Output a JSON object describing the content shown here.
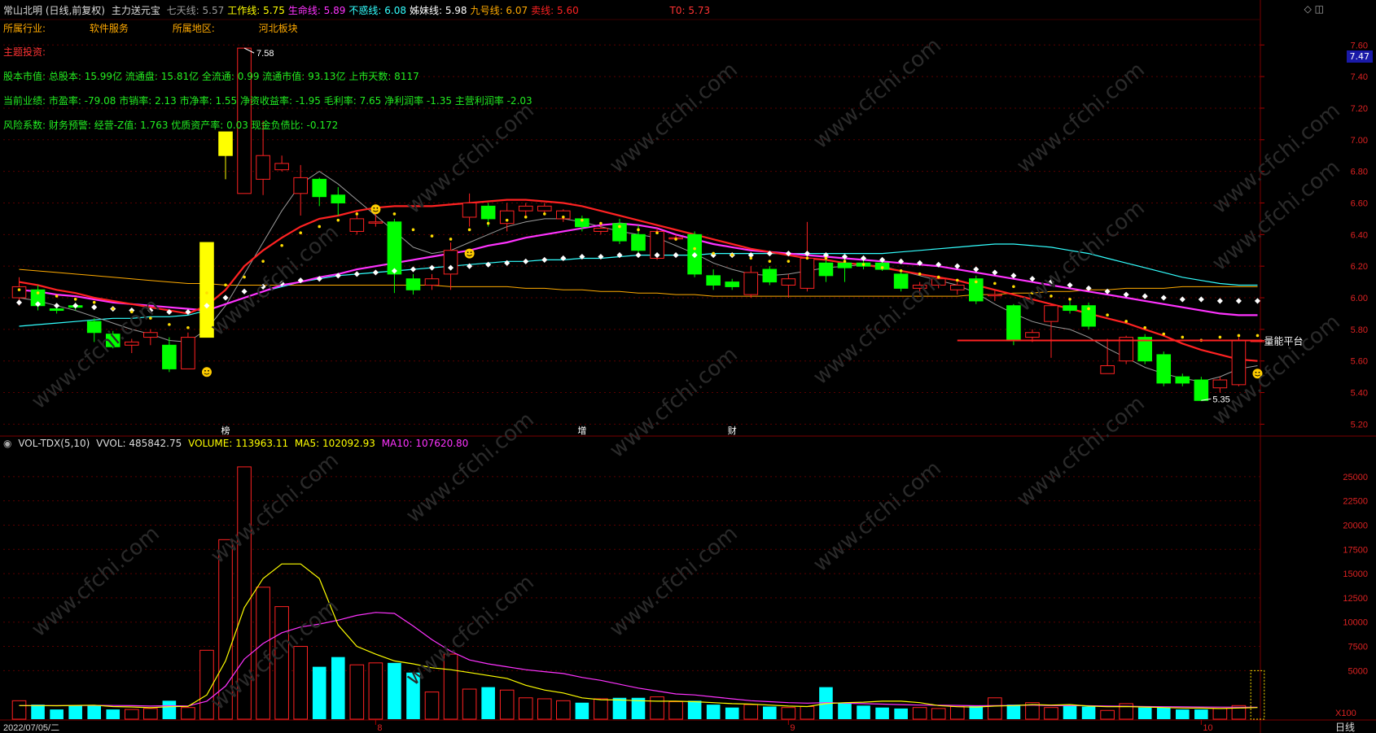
{
  "header": {
    "stock": "常山北明 (日线,前复权)",
    "indicator": "主力送元宝",
    "items": [
      {
        "label": "七天线:",
        "value": "5.57",
        "color": "#9a9a9a"
      },
      {
        "label": "工作线:",
        "value": "5.75",
        "color": "#ffff00"
      },
      {
        "label": "生命线:",
        "value": "5.89",
        "color": "#ff33ff"
      },
      {
        "label": "不惑线:",
        "value": "6.08",
        "color": "#33ffff"
      },
      {
        "label": "姊妹线:",
        "value": "5.98",
        "color": "#ffffff"
      },
      {
        "label": "九号线:",
        "value": "6.07",
        "color": "#ffaa00"
      },
      {
        "label": "卖线:",
        "value": "5.60",
        "color": "#ff2222"
      }
    ],
    "t0": "T0: 5.73"
  },
  "info": {
    "industry_label": "所属行业:",
    "industry_value": "软件服务",
    "region_label": "所属地区:",
    "region_value": "河北板块",
    "theme": "主题投资:",
    "capital": "股本市值: 总股本: 15.99亿 流通盘: 15.81亿 全流通: 0.99 流通市值: 93.13亿 上市天数: 8117",
    "performance": "当前业绩: 市盈率: -79.08 市销率: 2.13 市净率: 1.55 净资收益率: -1.95 毛利率: 7.65 净利润率 -1.35 主营利润率 -2.03",
    "risk": "风险系数: 财务预警: 经营-Z值: 1.763 优质资产率: 0.03 现金负债比: -0.172"
  },
  "annotations": {
    "high": "7.58",
    "low": "5.35",
    "platform": "量能平台",
    "markers": [
      "榜",
      "增",
      "财"
    ],
    "current_price": "7.47"
  },
  "volume_header": {
    "name": "VOL-TDX(5,10)",
    "vvol": "VVOL: 485842.75",
    "volume": "VOLUME: 113963.11",
    "ma5": "MA5: 102092.93",
    "ma10": "MA10: 107620.80"
  },
  "x_axis": {
    "start": "2022/07/05/二",
    "months": [
      "8",
      "9",
      "10"
    ],
    "unit": "X100",
    "period": "日线"
  },
  "colors": {
    "up": "#ff2222",
    "down": "#00ff00",
    "volume_down": "#00ffff",
    "ma_red": "#ff2222",
    "ma_magenta": "#ff33ff",
    "ma_cyan": "#33ffff",
    "ma_orange": "#ffaa00",
    "ma_gray": "#9a9a9a"
  },
  "chart_data": {
    "type": "candlestick",
    "y_ticks": [
      7.6,
      7.4,
      7.2,
      7.0,
      6.8,
      6.6,
      6.4,
      6.2,
      6.0,
      5.8,
      5.6,
      5.4,
      5.2
    ],
    "ylim": [
      5.13,
      7.73
    ],
    "volume_ticks": [
      25000,
      22500,
      20000,
      17500,
      15000,
      12500,
      10000,
      7500,
      5000
    ],
    "volume_ylim": [
      0,
      27500
    ],
    "candles": [
      [
        6.0,
        6.07,
        5.95,
        6.13
      ],
      [
        6.05,
        5.95,
        5.92,
        6.08
      ],
      [
        5.93,
        5.92,
        5.9,
        5.96
      ],
      [
        5.95,
        5.94,
        5.92,
        5.97
      ],
      [
        5.85,
        5.78,
        5.72,
        5.87
      ],
      [
        5.77,
        5.69,
        5.68,
        5.79
      ],
      [
        5.7,
        5.72,
        5.65,
        5.74
      ],
      [
        5.75,
        5.78,
        5.7,
        5.8
      ],
      [
        5.7,
        5.55,
        5.53,
        5.75
      ],
      [
        5.55,
        5.75,
        5.55,
        5.78
      ],
      [
        5.75,
        6.35,
        5.75,
        6.35
      ],
      [
        6.9,
        7.05,
        6.75,
        7.05
      ],
      [
        6.66,
        7.58,
        6.66,
        7.58
      ],
      [
        6.75,
        6.9,
        6.65,
        7.12
      ],
      [
        6.81,
        6.85,
        6.8,
        6.9
      ],
      [
        6.66,
        6.76,
        6.52,
        6.84
      ],
      [
        6.75,
        6.64,
        6.58,
        6.76
      ],
      [
        6.65,
        6.6,
        6.52,
        6.7
      ],
      [
        6.42,
        6.5,
        6.4,
        6.55
      ],
      [
        6.48,
        6.48,
        6.45,
        6.56
      ],
      [
        6.48,
        6.15,
        6.03,
        6.5
      ],
      [
        6.12,
        6.05,
        6.02,
        6.15
      ],
      [
        6.08,
        6.12,
        6.05,
        6.15
      ],
      [
        6.15,
        6.3,
        6.05,
        6.35
      ],
      [
        6.51,
        6.6,
        6.45,
        6.66
      ],
      [
        6.58,
        6.5,
        6.45,
        6.6
      ],
      [
        6.47,
        6.55,
        6.42,
        6.6
      ],
      [
        6.55,
        6.58,
        6.52,
        6.6
      ],
      [
        6.55,
        6.58,
        6.53,
        6.6
      ],
      [
        6.5,
        6.55,
        6.48,
        6.56
      ],
      [
        6.5,
        6.45,
        6.42,
        6.52
      ],
      [
        6.42,
        6.44,
        6.4,
        6.48
      ],
      [
        6.47,
        6.36,
        6.34,
        6.5
      ],
      [
        6.4,
        6.3,
        6.28,
        6.46
      ],
      [
        6.25,
        6.42,
        6.24,
        6.44
      ],
      [
        6.38,
        6.38,
        6.36,
        6.4
      ],
      [
        6.4,
        6.15,
        6.13,
        6.42
      ],
      [
        6.14,
        6.08,
        6.05,
        6.18
      ],
      [
        6.1,
        6.07,
        6.05,
        6.12
      ],
      [
        6.02,
        6.16,
        6.0,
        6.2
      ],
      [
        6.18,
        6.1,
        6.08,
        6.2
      ],
      [
        6.08,
        6.12,
        6.0,
        6.15
      ],
      [
        6.06,
        6.25,
        6.04,
        6.48
      ],
      [
        6.22,
        6.14,
        6.1,
        6.24
      ],
      [
        6.22,
        6.19,
        6.1,
        6.25
      ],
      [
        6.22,
        6.2,
        6.18,
        6.24
      ],
      [
        6.22,
        6.18,
        6.17,
        6.23
      ],
      [
        6.15,
        6.06,
        6.04,
        6.16
      ],
      [
        6.06,
        6.08,
        6.02,
        6.1
      ],
      [
        6.08,
        6.12,
        6.06,
        6.14
      ],
      [
        6.05,
        6.08,
        6.02,
        6.1
      ],
      [
        6.12,
        5.98,
        5.96,
        6.14
      ],
      [
        6.02,
        6.02,
        5.98,
        6.05
      ],
      [
        5.95,
        5.73,
        5.7,
        5.96
      ],
      [
        5.75,
        5.78,
        5.72,
        5.8
      ],
      [
        5.85,
        5.95,
        5.62,
        5.96
      ],
      [
        5.95,
        5.92,
        5.9,
        5.98
      ],
      [
        5.95,
        5.82,
        5.8,
        5.97
      ],
      [
        5.52,
        5.57,
        5.52,
        5.74
      ],
      [
        5.6,
        5.75,
        5.58,
        5.76
      ],
      [
        5.75,
        5.6,
        5.58,
        5.77
      ],
      [
        5.64,
        5.46,
        5.44,
        5.66
      ],
      [
        5.5,
        5.46,
        5.44,
        5.52
      ],
      [
        5.48,
        5.35,
        5.35,
        5.5
      ],
      [
        5.43,
        5.48,
        5.4,
        5.5
      ],
      [
        5.45,
        5.73,
        5.44,
        5.75
      ],
      [
        5.73,
        5.73,
        5.73,
        5.73
      ]
    ],
    "ma_red": [
      6.1,
      6.08,
      6.05,
      6.03,
      6.0,
      5.98,
      5.96,
      5.94,
      5.92,
      5.9,
      5.95,
      6.05,
      6.2,
      6.3,
      6.38,
      6.45,
      6.5,
      6.52,
      6.55,
      6.57,
      6.58,
      6.58,
      6.58,
      6.59,
      6.6,
      6.61,
      6.62,
      6.62,
      6.61,
      6.6,
      6.58,
      6.55,
      6.52,
      6.49,
      6.46,
      6.43,
      6.4,
      6.37,
      6.34,
      6.31,
      6.29,
      6.27,
      6.25,
      6.24,
      6.22,
      6.21,
      6.19,
      6.17,
      6.15,
      6.13,
      6.11,
      6.08,
      6.05,
      6.02,
      5.99,
      5.96,
      5.93,
      5.9,
      5.87,
      5.84,
      5.8,
      5.76,
      5.71,
      5.67,
      5.64,
      5.61,
      5.6
    ],
    "ma_magenta": [
      6.05,
      6.04,
      6.02,
      6.01,
      5.99,
      5.97,
      5.96,
      5.95,
      5.94,
      5.93,
      5.92,
      5.96,
      6.0,
      6.04,
      6.08,
      6.1,
      6.13,
      6.15,
      6.18,
      6.2,
      6.22,
      6.24,
      6.26,
      6.28,
      6.3,
      6.33,
      6.35,
      6.38,
      6.4,
      6.42,
      6.44,
      6.46,
      6.47,
      6.46,
      6.44,
      6.4,
      6.37,
      6.34,
      6.32,
      6.3,
      6.29,
      6.28,
      6.27,
      6.26,
      6.25,
      6.24,
      6.23,
      6.22,
      6.21,
      6.2,
      6.18,
      6.16,
      6.14,
      6.12,
      6.1,
      6.08,
      6.06,
      6.04,
      6.02,
      6.0,
      5.98,
      5.96,
      5.94,
      5.92,
      5.9,
      5.89,
      5.89
    ],
    "ma_cyan": [
      5.82,
      5.83,
      5.84,
      5.85,
      5.86,
      5.87,
      5.87,
      5.88,
      5.88,
      5.89,
      5.92,
      5.96,
      6.0,
      6.04,
      6.07,
      6.1,
      6.12,
      6.14,
      6.15,
      6.16,
      6.17,
      6.18,
      6.19,
      6.2,
      6.21,
      6.22,
      6.23,
      6.23,
      6.24,
      6.24,
      6.25,
      6.25,
      6.26,
      6.27,
      6.27,
      6.27,
      6.27,
      6.28,
      6.28,
      6.28,
      6.28,
      6.28,
      6.28,
      6.28,
      6.28,
      6.28,
      6.28,
      6.29,
      6.3,
      6.31,
      6.32,
      6.33,
      6.34,
      6.34,
      6.33,
      6.32,
      6.3,
      6.28,
      6.25,
      6.22,
      6.19,
      6.16,
      6.13,
      6.11,
      6.09,
      6.08,
      6.08
    ],
    "ma_orange": [
      6.18,
      6.17,
      6.16,
      6.15,
      6.14,
      6.13,
      6.12,
      6.11,
      6.1,
      6.09,
      6.09,
      6.08,
      6.08,
      6.08,
      6.08,
      6.08,
      6.08,
      6.08,
      6.08,
      6.08,
      6.08,
      6.08,
      6.08,
      6.07,
      6.07,
      6.07,
      6.07,
      6.06,
      6.06,
      6.05,
      6.05,
      6.04,
      6.04,
      6.03,
      6.03,
      6.02,
      6.02,
      6.01,
      6.01,
      6.01,
      6.01,
      6.01,
      6.01,
      6.01,
      6.01,
      6.01,
      6.01,
      6.01,
      6.01,
      6.01,
      6.01,
      6.02,
      6.02,
      6.03,
      6.03,
      6.04,
      6.04,
      6.05,
      6.05,
      6.06,
      6.06,
      6.06,
      6.07,
      6.07,
      6.07,
      6.07,
      6.07
    ],
    "ma_gray": [
      6.0,
      5.98,
      5.95,
      5.92,
      5.88,
      5.84,
      5.8,
      5.77,
      5.73,
      5.72,
      5.8,
      5.95,
      6.15,
      6.35,
      6.55,
      6.72,
      6.8,
      6.72,
      6.62,
      6.52,
      6.42,
      6.32,
      6.28,
      6.3,
      6.35,
      6.4,
      6.45,
      6.48,
      6.5,
      6.5,
      6.48,
      6.45,
      6.42,
      6.4,
      6.38,
      6.33,
      6.28,
      6.22,
      6.18,
      6.15,
      6.14,
      6.15,
      6.17,
      6.19,
      6.2,
      6.21,
      6.2,
      6.17,
      6.14,
      6.11,
      6.08,
      6.03,
      5.96,
      5.9,
      5.85,
      5.82,
      5.8,
      5.75,
      5.68,
      5.62,
      5.56,
      5.52,
      5.49,
      5.47,
      5.5,
      5.55,
      5.57
    ],
    "dots_white": [
      5.97,
      5.96,
      5.95,
      5.95,
      5.94,
      5.93,
      5.92,
      5.92,
      5.91,
      5.91,
      5.95,
      6.0,
      6.04,
      6.07,
      6.09,
      6.11,
      6.12,
      6.14,
      6.15,
      6.16,
      6.17,
      6.18,
      6.19,
      6.19,
      6.2,
      6.21,
      6.22,
      6.23,
      6.24,
      6.25,
      6.26,
      6.26,
      6.27,
      6.27,
      6.27,
      6.27,
      6.27,
      6.27,
      6.27,
      6.27,
      6.28,
      6.28,
      6.28,
      6.27,
      6.26,
      6.25,
      6.24,
      6.23,
      6.22,
      6.21,
      6.2,
      6.18,
      6.16,
      6.14,
      6.12,
      6.1,
      6.08,
      6.06,
      6.04,
      6.02,
      6.01,
      6.0,
      5.99,
      5.99,
      5.98,
      5.98,
      5.98
    ],
    "dots_yellow": [
      6.02,
      6.0,
      5.98,
      5.96,
      5.94,
      5.9,
      5.88,
      5.84,
      5.8,
      5.78,
      6.0,
      6.05,
      6.1,
      6.2,
      6.3,
      6.38,
      6.42,
      6.46,
      6.5,
      6.52,
      6.5,
      6.4,
      6.36,
      6.34,
      6.4,
      6.44,
      6.46,
      6.48,
      6.5,
      6.48,
      6.46,
      6.44,
      6.42,
      6.4,
      6.38,
      6.34,
      6.28,
      6.25,
      6.24,
      6.22,
      6.2,
      6.2,
      6.22,
      6.22,
      6.2,
      6.18,
      6.16,
      6.14,
      6.12,
      6.1,
      6.08,
      6.07,
      6.06,
      6.04,
      6.0,
      5.98,
      5.96,
      5.9,
      5.86,
      5.82,
      5.78,
      5.74,
      5.72,
      5.7,
      5.72,
      5.73,
      5.73
    ],
    "volume": [
      1900,
      1500,
      1000,
      1400,
      1400,
      1000,
      1000,
      1100,
      1900,
      1200,
      7100,
      18500,
      26000,
      13600,
      11600,
      7500,
      5400,
      6400,
      5600,
      5800,
      5800,
      4800,
      2800,
      6700,
      3100,
      3300,
      3000,
      2200,
      2100,
      1900,
      1700,
      2100,
      2200,
      2200,
      2300,
      1800,
      1900,
      1500,
      1200,
      1500,
      1300,
      1200,
      1300,
      3300,
      1700,
      1400,
      1200,
      1100,
      1200,
      1100,
      1300,
      1400,
      2200,
      1500,
      1700,
      1200,
      1400,
      1300,
      900,
      1600,
      1200,
      1200,
      1000,
      1000,
      1100,
      1400,
      5000
    ],
    "volume_ma5": [
      1400,
      1400,
      1380,
      1420,
      1440,
      1300,
      1260,
      1180,
      1280,
      1320,
      2500,
      6000,
      11500,
      14500,
      16000,
      16000,
      14500,
      9700,
      7500,
      6700,
      6000,
      5700,
      5300,
      5100,
      4800,
      4500,
      4200,
      3500,
      3000,
      2700,
      2200,
      2000,
      1980,
      1900,
      1850,
      1850,
      1800,
      1700,
      1600,
      1550,
      1450,
      1350,
      1300,
      1600,
      1700,
      1750,
      1850,
      1850,
      1700,
      1400,
      1280,
      1250,
      1350,
      1400,
      1500,
      1450,
      1500,
      1350,
      1280,
      1300,
      1250,
      1200,
      1150,
      1140,
      1100,
      1150,
      1200
    ],
    "volume_ma10": [
      1400,
      1400,
      1400,
      1410,
      1420,
      1410,
      1390,
      1350,
      1380,
      1360,
      1850,
      3400,
      6200,
      7800,
      8900,
      9500,
      9800,
      10200,
      10700,
      11000,
      10900,
      9600,
      8200,
      7000,
      6100,
      5700,
      5400,
      5100,
      4900,
      4700,
      4300,
      4000,
      3600,
      3200,
      2900,
      2600,
      2500,
      2300,
      2100,
      1900,
      1800,
      1700,
      1650,
      1700,
      1650,
      1600,
      1550,
      1500,
      1450,
      1430,
      1420,
      1380,
      1400,
      1420,
      1450,
      1400,
      1400,
      1380,
      1350,
      1330,
      1300,
      1280,
      1270,
      1250,
      1240,
      1230,
      1220
    ]
  }
}
